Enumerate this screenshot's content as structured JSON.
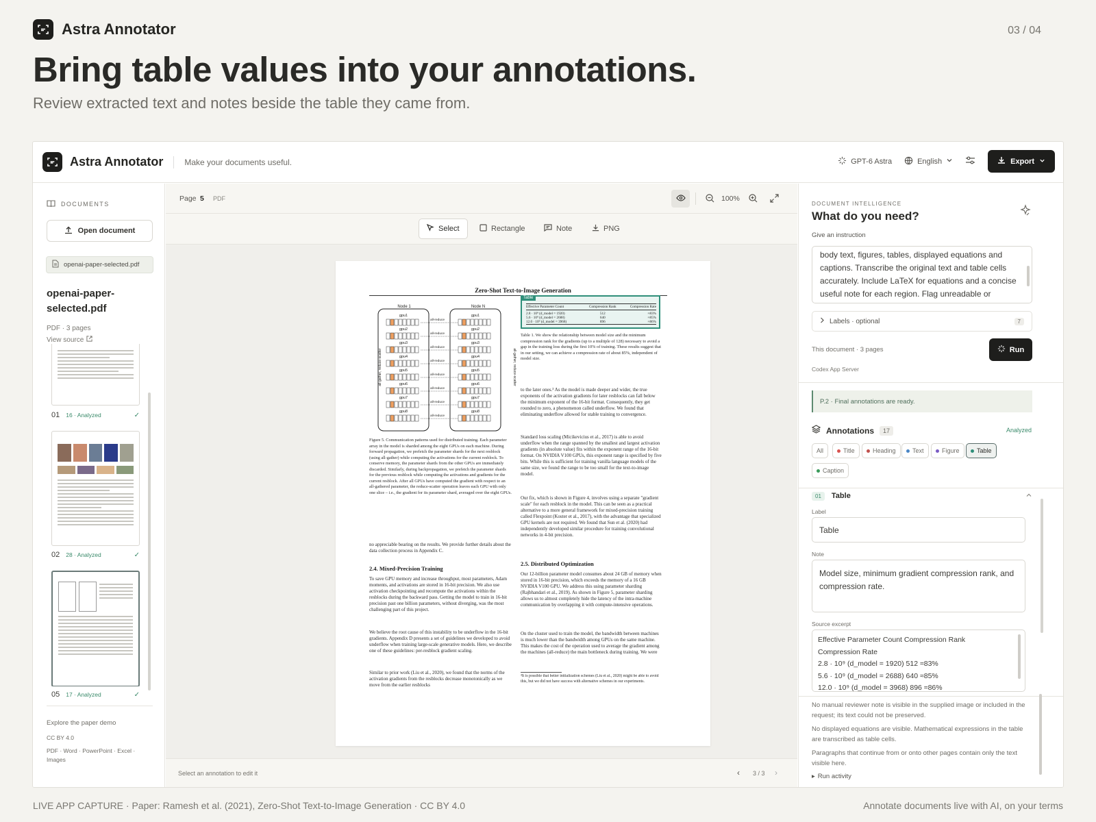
{
  "header": {
    "brand": "Astra Annotator",
    "page_indicator": "03 / 04",
    "headline": "Bring table values into your annotations.",
    "subheadline": "Review extracted text and notes beside the table they came from."
  },
  "footer": {
    "left": "LIVE APP CAPTURE · Paper: Ramesh et al. (2021), Zero-Shot Text-to-Image Generation · CC BY 4.0",
    "right": "Annotate documents live with AI, on your terms"
  },
  "app": {
    "name": "Astra Annotator",
    "tagline": "Make your documents useful.",
    "model": "GPT-6 Astra",
    "language": "English",
    "export_label": "Export"
  },
  "sidebar": {
    "section_label": "DOCUMENTS",
    "open_button": "Open document",
    "file_chip": "openai-paper-selected.pdf",
    "doc_title": "openai-paper-selected.pdf",
    "doc_meta": "PDF · 3 pages",
    "view_source": "View source",
    "thumbnails": [
      {
        "num": "01",
        "status": "16 · Analyzed"
      },
      {
        "num": "02",
        "status": "28 · Analyzed"
      },
      {
        "num": "05",
        "status": "17 · Analyzed"
      }
    ],
    "footer_link": "Explore the paper demo",
    "license": "CC BY 4.0",
    "formats": "PDF · Word · PowerPoint · Excel · Images"
  },
  "viewer": {
    "page_label": "Page",
    "page_number": "5",
    "file_type": "PDF",
    "zoom": "100%",
    "tools": [
      "Select",
      "Rectangle",
      "Note",
      "PNG"
    ],
    "status_hint": "Select an annotation to edit it",
    "pagination": "3 / 3"
  },
  "paper": {
    "title": "Zero-Shot Text-to-Image Generation",
    "table_tag": "Table",
    "table_headers": [
      "Effective Parameter Count",
      "Compression Rank",
      "Compression Rate"
    ],
    "table_rows": [
      [
        "2.8 · 10⁹ (d_model = 1920)",
        "512",
        "≈83%"
      ],
      [
        "5.6 · 10⁹ (d_model = 2688)",
        "640",
        "≈85%"
      ],
      [
        "12.0 · 10⁹ (d_model = 3968)",
        "896",
        "≈86%"
      ]
    ],
    "node_left": "Node 1",
    "node_right": "Node N",
    "gpus": [
      "gpu1",
      "gpu2",
      "gpu3",
      "gpu4",
      "gpu5",
      "gpu6",
      "gpu7",
      "gpu8"
    ],
    "link_label": "all-reduce",
    "side_left": "all-gather, reduce-scatter",
    "side_right": "all-gather, reduce-scatter",
    "fig_caption": "Figure 5. Communication patterns used for distributed training. Each parameter array in the model is sharded among the eight GPUs on each machine. During forward propagation, we prefetch the parameter shards for the next resblock (using all-gather) while computing the activations for the current resblock. To conserve memory, the parameter shards from the other GPUs are immediately discarded. Similarly, during backpropagation, we prefetch the parameter shards for the previous resblock while computing the activations and gradients for the current resblock. After all GPUs have computed the gradient with respect to an all-gathered parameter, the reduce-scatter operation leaves each GPU with only one slice – i.e., the gradient for its parameter shard, averaged over the eight GPUs.",
    "table_caption": "Table 1. We show the relationship between model size and the minimum compression rank for the gradients (up to a multiple of 128) necessary to avoid a gap in the training loss during the first 10% of training. These results suggest that in our setting, we can achieve a compression rate of about 85%, independent of model size.",
    "left_p1": "no appreciable bearing on the results. We provide further details about the data collection process in Appendix C.",
    "left_h1": "2.4. Mixed-Precision Training",
    "left_p2": "To save GPU memory and increase throughput, most parameters, Adam moments, and activations are stored in 16-bit precision. We also use activation checkpointing and recompute the activations within the resblocks during the backward pass. Getting the model to train in 16-bit precision past one billion parameters, without diverging, was the most challenging part of this project.",
    "left_p3": "We believe the root cause of this instability to be underflow in the 16-bit gradients. Appendix D presents a set of guidelines we developed to avoid underflow when training large-scale generative models. Here, we describe one of these guidelines: per-resblock gradient scaling.",
    "left_p4": "Similar to prior work (Liu et al., 2020), we found that the norms of the activation gradients from the resblocks decrease monotonically as we move from the earlier resblocks",
    "right_p1": "to the later ones.³ As the model is made deeper and wider, the true exponents of the activation gradients for later resblocks can fall below the minimum exponent of the 16-bit format. Consequently, they get rounded to zero, a phenomenon called underflow. We found that eliminating underflow allowed for stable training to convergence.",
    "right_p2": "Standard loss scaling (Micikevicius et al., 2017) is able to avoid underflow when the range spanned by the smallest and largest activation gradients (in absolute value) fits within the exponent range of the 16-bit format. On NVIDIA V100 GPUs, this exponent range is specified by five bits. While this is sufficient for training vanilla language models of the same size, we found the range to be too small for the text-to-image model.",
    "right_p3": "Our fix, which is shown in Figure 4, involves using a separate \"gradient scale\" for each resblock in the model. This can be seen as a practical alternative to a more general framework for mixed-precision training called Flexpoint (Koster et al., 2017), with the advantage that specialized GPU kernels are not required. We found that Sun et al. (2020) had independently developed similar procedure for training convolutional networks in 4-bit precision.",
    "right_h1": "2.5. Distributed Optimization",
    "right_p4": "Our 12-billion parameter model consumes about 24 GB of memory when stored in 16-bit precision, which exceeds the memory of a 16 GB NVIDIA V100 GPU. We address this using parameter sharding (Rajbhandari et al., 2019). As shown in Figure 5, parameter sharding allows us to almost completely hide the latency of the intra-machine communication by overlapping it with compute-intensive operations.",
    "right_p5": "On the cluster used to train the model, the bandwidth between machines is much lower than the bandwidth among GPUs on the same machine. This makes the cost of the operation used to average the gradient among the machines (all-reduce) the main bottleneck during training. We were",
    "footnote": "³It is possible that better initialization schemes (Liu et al., 2020) might be able to avoid this, but we did not have success with alternative schemes in our experiments."
  },
  "panel": {
    "section_label": "DOCUMENT INTELLIGENCE",
    "title": "What do you need?",
    "instruction_label": "Give an instruction",
    "instruction_text": "body text, figures, tables, displayed equations and captions. Transcribe the original text and table cells accurately. Include LaTeX for equations and a concise useful note for each region. Flag unreadable or uncertain content. Preserve my manual reviewer note.",
    "labels_toggle": "Labels · optional",
    "labels_count": "7",
    "doc_info": "This document · 3 pages",
    "run_label": "Run",
    "server": "Codex App Server",
    "ready_msg": "P.2 · Final annotations are ready.",
    "annotations_label": "Annotations",
    "annotations_count": "17",
    "analyzed": "Analyzed",
    "filters": [
      {
        "label": "All",
        "color": ""
      },
      {
        "label": "Title",
        "color": "#d9534f"
      },
      {
        "label": "Heading",
        "color": "#c0504d"
      },
      {
        "label": "Text",
        "color": "#4a86c5"
      },
      {
        "label": "Figure",
        "color": "#7a5cc4"
      },
      {
        "label": "Table",
        "color": "#2f8f7a"
      },
      {
        "label": "Caption",
        "color": "#3a9a5a"
      }
    ],
    "active_filter": "Table",
    "item_num": "01",
    "item_type": "Table",
    "label_field_label": "Label",
    "label_value": "Table",
    "note_label": "Note",
    "note_value": "Model size, minimum gradient compression rank, and compression rate.",
    "source_label": "Source excerpt",
    "source_lines": [
      "Effective Parameter Count   Compression Rank",
      "Compression Rate",
      "2.8 · 10⁹ (d_model = 1920)   512  ≈83%",
      "5.6 · 10⁹ (d_model = 2688)   640  ≈85%",
      "12.0 · 10⁹ (d_model = 3968) 896 ≈86%"
    ],
    "notices": [
      "No manual reviewer note is visible in the supplied image or included in the request; its text could not be preserved.",
      "No displayed equations are visible. Mathematical expressions in the table are transcribed as table cells.",
      "Paragraphs that continue from or onto other pages contain only the text visible here."
    ],
    "run_activity": "Run activity"
  }
}
